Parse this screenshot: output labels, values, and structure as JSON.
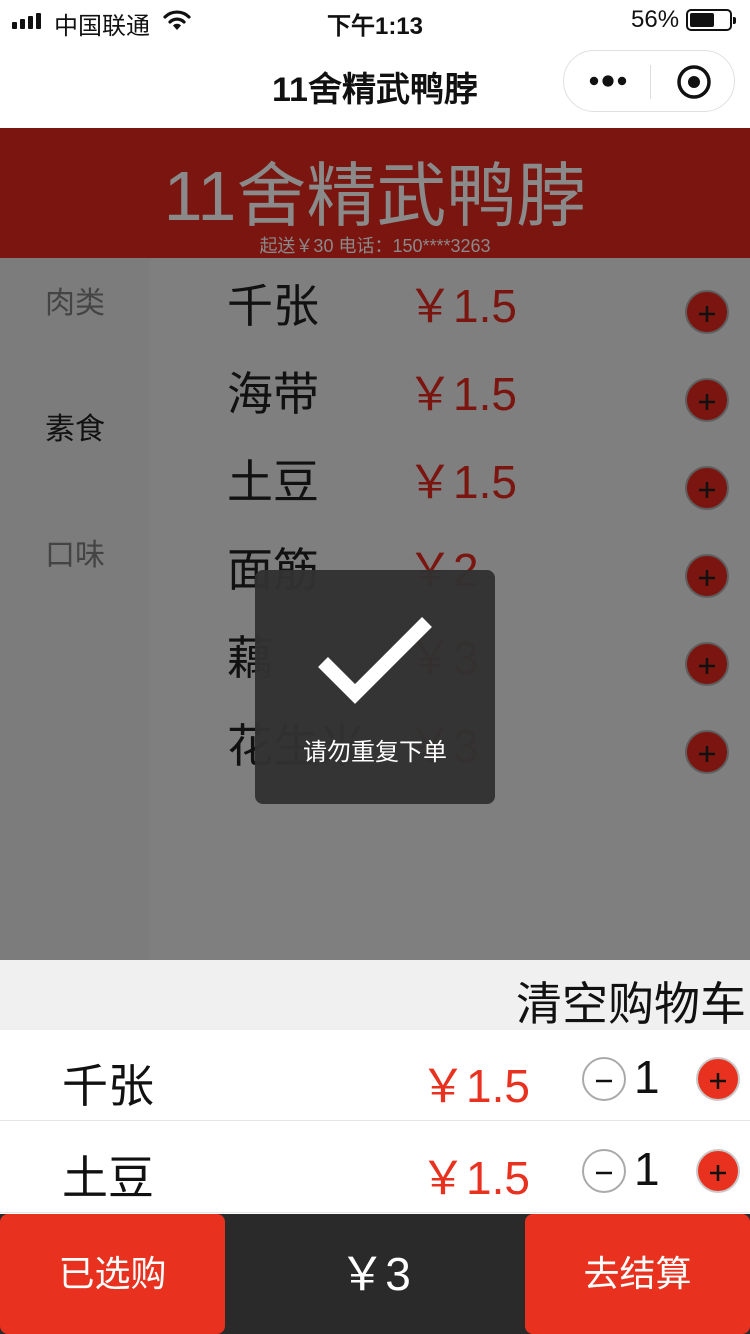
{
  "status_bar": {
    "carrier": "中国联通",
    "time": "下午1:13",
    "battery": "56%",
    "battery_level": 0.56
  },
  "navbar": {
    "title": "11舍精武鸭脖",
    "more_icon": "more-dots-icon",
    "close_icon": "target-circle-icon"
  },
  "banner": {
    "shop_name": "11舍精武鸭脖",
    "info": "起送￥30 电话：150****3263"
  },
  "sidebar": {
    "items": [
      {
        "label": "肉类",
        "active": false
      },
      {
        "label": "素食",
        "active": true
      },
      {
        "label": "口味",
        "active": false
      }
    ]
  },
  "products": [
    {
      "name": "千张",
      "price": "￥1.5"
    },
    {
      "name": "海带",
      "price": "￥1.5"
    },
    {
      "name": "土豆",
      "price": "￥1.5"
    },
    {
      "name": "面筋",
      "price": "￥2"
    },
    {
      "name": "藕",
      "price": "￥3"
    },
    {
      "name": "花生米",
      "price": "￥3"
    }
  ],
  "cart": {
    "clear_label": "清空购物车",
    "items": [
      {
        "name": "千张",
        "price": "￥1.5",
        "qty": "1"
      },
      {
        "name": "土豆",
        "price": "￥1.5",
        "qty": "1"
      }
    ]
  },
  "bottom_bar": {
    "selected_label": "已选购",
    "total": "￥3",
    "checkout_label": "去结算"
  },
  "toast": {
    "message": "请勿重复下单",
    "icon": "checkmark-icon"
  },
  "colors": {
    "brand_dark_red": "#7a1510",
    "accent_red": "#e8321f",
    "overlay_gray": "#7f7f7f"
  }
}
